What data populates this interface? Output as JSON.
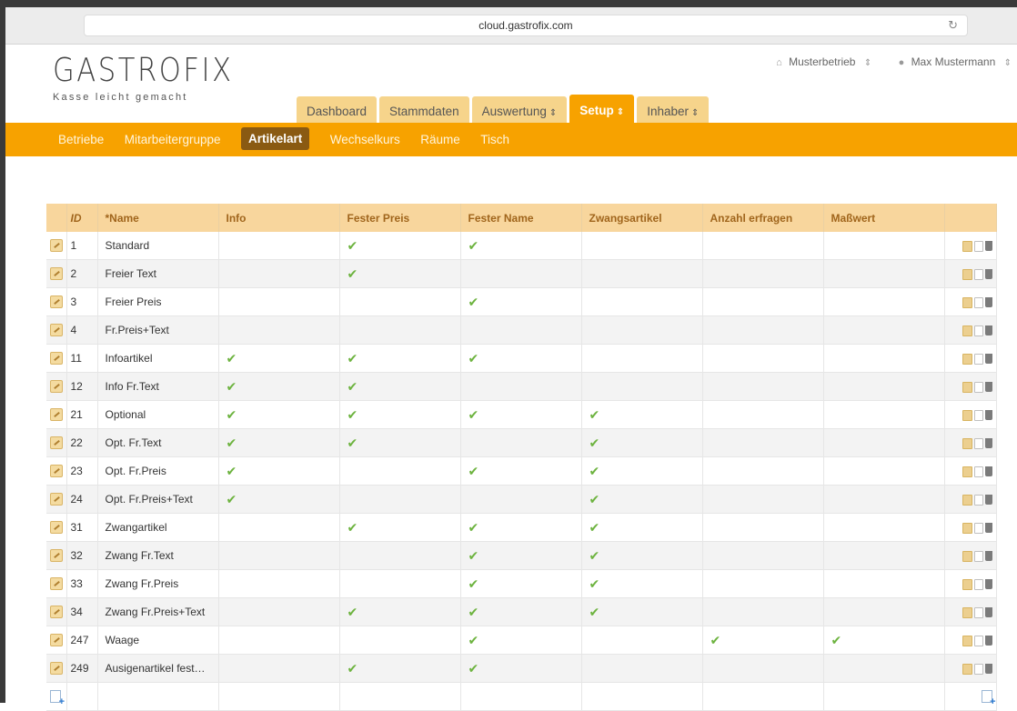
{
  "browser": {
    "url": "cloud.gastrofix.com",
    "reload_icon": "reload-icon"
  },
  "brand": {
    "name": "GASTROFIX",
    "tagline": "Kasse leicht gemacht"
  },
  "topbar": {
    "business": "Musterbetrieb",
    "user": "Max Mustermann",
    "business_icon": "home-icon",
    "user_icon": "user-icon"
  },
  "main_tabs": [
    {
      "label": "Dashboard"
    },
    {
      "label": "Stammdaten"
    },
    {
      "label": "Auswertung"
    },
    {
      "label": "Setup"
    },
    {
      "label": "Inhaber"
    }
  ],
  "sub_nav": [
    {
      "label": "Betriebe"
    },
    {
      "label": "Mitarbeitergruppe"
    },
    {
      "label": "Artikelart"
    },
    {
      "label": "Wechselkurs"
    },
    {
      "label": "Räume"
    },
    {
      "label": "Tisch"
    }
  ],
  "table": {
    "headers": {
      "id": "ID",
      "name": "*Name",
      "info": "Info",
      "fester_preis": "Fester Preis",
      "fester_name": "Fester Name",
      "zwangsartikel": "Zwangsartikel",
      "anzahl_erfragen": "Anzahl erfragen",
      "masswert": "Maßwert"
    },
    "check_symbol": "✔",
    "rows": [
      {
        "id": "1",
        "name": "Standard",
        "info": false,
        "fester_preis": true,
        "fester_name": true,
        "zwangsartikel": false,
        "anzahl_erfragen": false,
        "masswert": false
      },
      {
        "id": "2",
        "name": "Freier Text",
        "info": false,
        "fester_preis": true,
        "fester_name": false,
        "zwangsartikel": false,
        "anzahl_erfragen": false,
        "masswert": false
      },
      {
        "id": "3",
        "name": "Freier Preis",
        "info": false,
        "fester_preis": false,
        "fester_name": true,
        "zwangsartikel": false,
        "anzahl_erfragen": false,
        "masswert": false
      },
      {
        "id": "4",
        "name": "Fr.Preis+Text",
        "info": false,
        "fester_preis": false,
        "fester_name": false,
        "zwangsartikel": false,
        "anzahl_erfragen": false,
        "masswert": false
      },
      {
        "id": "11",
        "name": "Infoartikel",
        "info": true,
        "fester_preis": true,
        "fester_name": true,
        "zwangsartikel": false,
        "anzahl_erfragen": false,
        "masswert": false
      },
      {
        "id": "12",
        "name": "Info Fr.Text",
        "info": true,
        "fester_preis": true,
        "fester_name": false,
        "zwangsartikel": false,
        "anzahl_erfragen": false,
        "masswert": false
      },
      {
        "id": "21",
        "name": "Optional",
        "info": true,
        "fester_preis": true,
        "fester_name": true,
        "zwangsartikel": true,
        "anzahl_erfragen": false,
        "masswert": false
      },
      {
        "id": "22",
        "name": "Opt. Fr.Text",
        "info": true,
        "fester_preis": true,
        "fester_name": false,
        "zwangsartikel": true,
        "anzahl_erfragen": false,
        "masswert": false
      },
      {
        "id": "23",
        "name": "Opt. Fr.Preis",
        "info": true,
        "fester_preis": false,
        "fester_name": true,
        "zwangsartikel": true,
        "anzahl_erfragen": false,
        "masswert": false
      },
      {
        "id": "24",
        "name": "Opt. Fr.Preis+Text",
        "info": true,
        "fester_preis": false,
        "fester_name": false,
        "zwangsartikel": true,
        "anzahl_erfragen": false,
        "masswert": false
      },
      {
        "id": "31",
        "name": "Zwangartikel",
        "info": false,
        "fester_preis": true,
        "fester_name": true,
        "zwangsartikel": true,
        "anzahl_erfragen": false,
        "masswert": false
      },
      {
        "id": "32",
        "name": "Zwang Fr.Text",
        "info": false,
        "fester_preis": false,
        "fester_name": true,
        "zwangsartikel": true,
        "anzahl_erfragen": false,
        "masswert": false
      },
      {
        "id": "33",
        "name": "Zwang Fr.Preis",
        "info": false,
        "fester_preis": false,
        "fester_name": true,
        "zwangsartikel": true,
        "anzahl_erfragen": false,
        "masswert": false
      },
      {
        "id": "34",
        "name": "Zwang Fr.Preis+Text",
        "info": false,
        "fester_preis": true,
        "fester_name": true,
        "zwangsartikel": true,
        "anzahl_erfragen": false,
        "masswert": false
      },
      {
        "id": "247",
        "name": "Waage",
        "info": false,
        "fester_preis": false,
        "fester_name": true,
        "zwangsartikel": false,
        "anzahl_erfragen": true,
        "masswert": true
      },
      {
        "id": "249",
        "name": "Ausigenartikel fest…",
        "info": false,
        "fester_preis": true,
        "fester_name": true,
        "zwangsartikel": false,
        "anzahl_erfragen": false,
        "masswert": false
      }
    ]
  },
  "colors": {
    "brand_orange": "#f7a200",
    "tab_inactive": "#f6d48b",
    "active_subnav": "#8a5a12",
    "table_header": "#f8d69d",
    "check_green": "#6db33f"
  }
}
